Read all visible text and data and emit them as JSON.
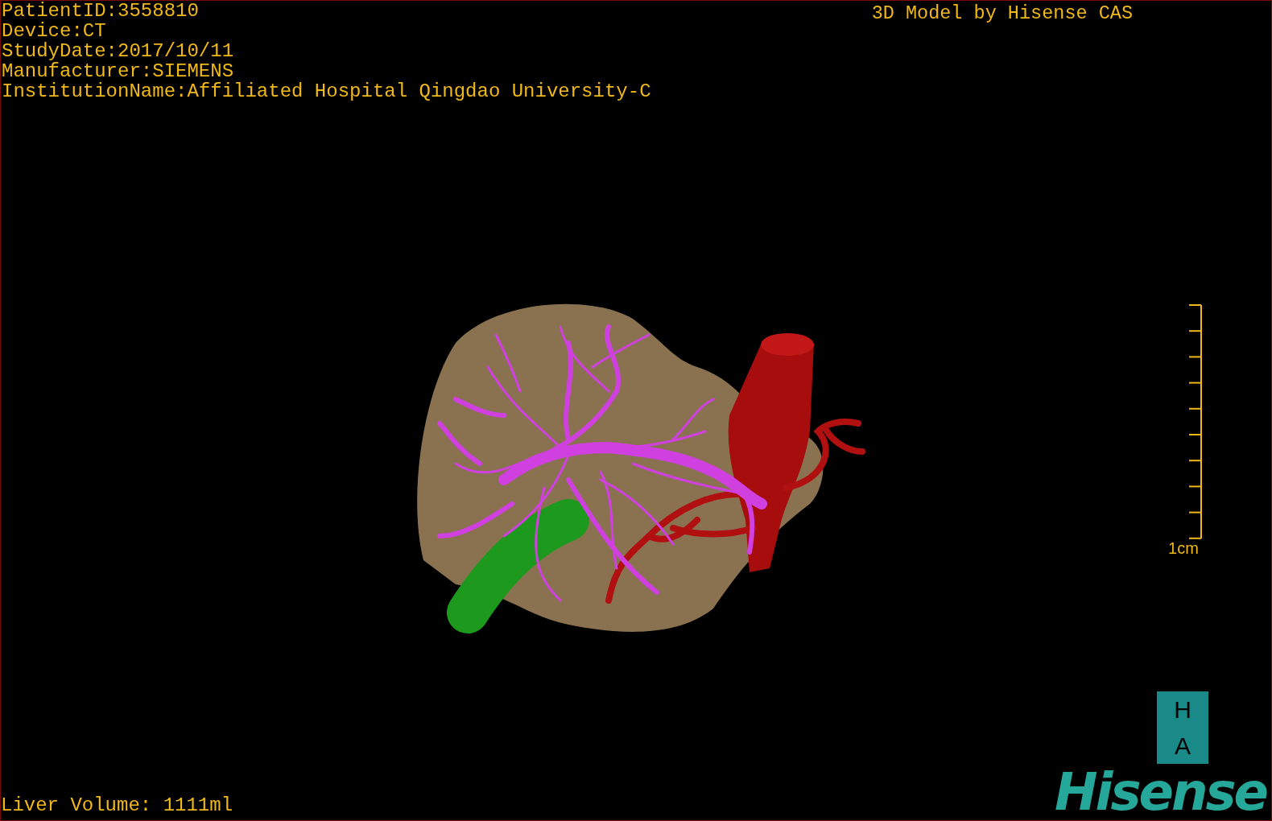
{
  "patient_info": [
    "PatientID:3558810",
    "Device:CT",
    "StudyDate:2017/10/11",
    "Manufacturer:SIEMENS",
    "InstitutionName:Affiliated Hospital Qingdao University-C"
  ],
  "viewer_title": "3D Model by Hisense CAS",
  "scale_bar": {
    "label": "1cm"
  },
  "liver_volume": "Liver Volume: 1111ml",
  "logo": {
    "badge_letters": [
      "H",
      "A"
    ],
    "wordmark": "Hisense"
  }
}
